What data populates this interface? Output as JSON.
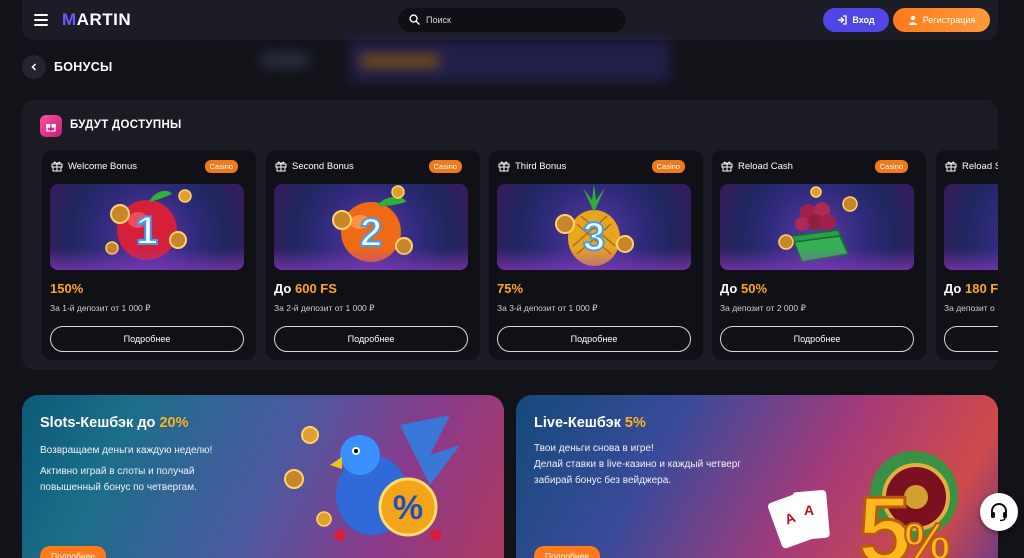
{
  "header": {
    "logo_text": "MARTIN",
    "search_placeholder": "Поиск",
    "login_label": "Вход",
    "register_label": "Регистрация"
  },
  "page": {
    "title": "БОНУСЫ"
  },
  "section": {
    "title": "БУДУТ ДОСТУПНЫ",
    "cards": [
      {
        "title": "Welcome Bonus",
        "badge": "Casino",
        "amount_prefix": "",
        "amount": "150%",
        "desc": "За 1-й депозит от 1 000 ₽",
        "button": "Подробнее",
        "art_digit": "1"
      },
      {
        "title": "Second Bonus",
        "badge": "Casino",
        "amount_prefix": "До ",
        "amount": "600 FS",
        "desc": "За 2-й депозит от 1 000 ₽",
        "button": "Подробнее",
        "art_digit": "2"
      },
      {
        "title": "Third Bonus",
        "badge": "Casino",
        "amount_prefix": "",
        "amount": "75%",
        "desc": "За 3-й депозит от 1 000 ₽",
        "button": "Подробнее",
        "art_digit": "3"
      },
      {
        "title": "Reload Cash",
        "badge": "Casino",
        "amount_prefix": "До ",
        "amount": "50%",
        "desc": "За депозит от 2 000 ₽",
        "button": "Подробнее",
        "art_digit": ""
      },
      {
        "title": "Reload S",
        "badge": "",
        "amount_prefix": "До ",
        "amount": "180 F",
        "desc": "За депозит о",
        "button": "",
        "art_digit": ""
      }
    ]
  },
  "promos": [
    {
      "title_prefix": "Slots-Кешбэк до ",
      "title_highlight": "20%",
      "lines_a": "Возвращаем деньги каждую неделю!",
      "lines_b": "Активно играй в слоты и получай",
      "lines_c": "повышенный бонус по четвергам.",
      "button": "Подробнее"
    },
    {
      "title_prefix": "Live-Кешбэк ",
      "title_highlight": "5%",
      "lines_a": "Твои деньги снова в игре!",
      "lines_b": "Делай ставки в live-казино и каждый четверг",
      "lines_c": "забирай бонус без вейджера.",
      "button": "Подробнее"
    }
  ],
  "colors": {
    "accent_orange": "#ff7a1a",
    "accent_purple": "#4f46e5",
    "highlight": "#ffa51f"
  }
}
